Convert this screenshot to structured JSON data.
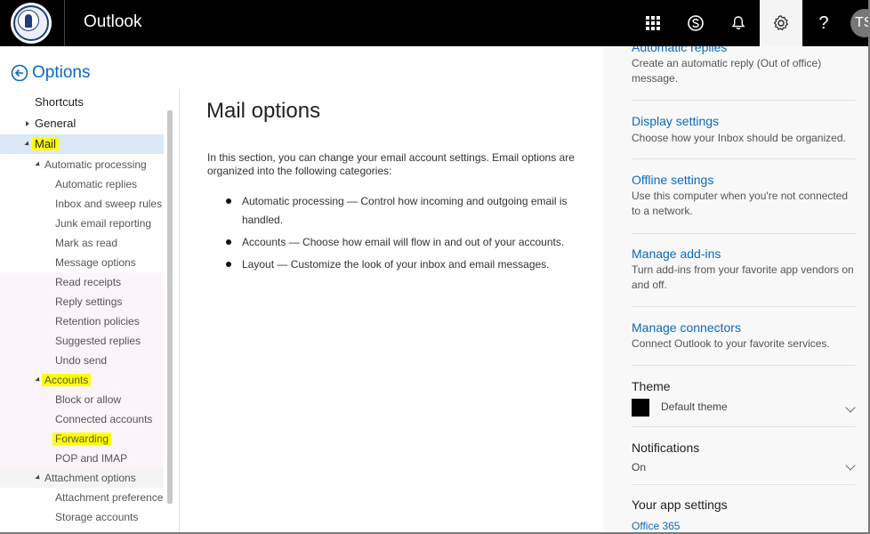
{
  "header": {
    "app_name": "Outlook",
    "avatar_initials": "TS",
    "icons": [
      "app-launcher-icon",
      "skype-icon",
      "bell-icon",
      "gear-icon",
      "help-icon"
    ],
    "help_glyph": "?"
  },
  "options_back": {
    "label": "Options"
  },
  "nav": {
    "shortcuts": "Shortcuts",
    "general": "General",
    "mail": "Mail",
    "automatic_processing": "Automatic processing",
    "automatic_replies": "Automatic replies",
    "inbox_rules": "Inbox and sweep rules",
    "junk": "Junk email reporting",
    "mark_read": "Mark as read",
    "message_options": "Message options",
    "read_receipts": "Read receipts",
    "reply_settings": "Reply settings",
    "retention": "Retention policies",
    "suggested_replies": "Suggested replies",
    "undo_send": "Undo send",
    "accounts": "Accounts",
    "block_allow": "Block or allow",
    "connected_accounts": "Connected accounts",
    "forwarding": "Forwarding",
    "pop_imap": "POP and IMAP",
    "attachment_options": "Attachment options",
    "attachment_preference": "Attachment preference",
    "storage_accounts": "Storage accounts"
  },
  "main": {
    "title": "Mail options",
    "intro": "In this section, you can change your email account settings. Email options are organized into the following categories:",
    "bullets": [
      "Automatic processing — Control how incoming and outgoing email is handled.",
      "Accounts — Choose how email will flow in and out of your accounts.",
      "Layout — Customize the look of your inbox and email messages."
    ]
  },
  "right_panel": {
    "automatic_replies": {
      "title": "Automatic replies",
      "desc": "Create an automatic reply (Out of office) message."
    },
    "display_settings": {
      "title": "Display settings",
      "desc": "Choose how your Inbox should be organized."
    },
    "offline_settings": {
      "title": "Offline settings",
      "desc": "Use this computer when you're not connected to a network."
    },
    "manage_addins": {
      "title": "Manage add-ins",
      "desc": "Turn add-ins from your favorite app vendors on and off."
    },
    "manage_connectors": {
      "title": "Manage connectors",
      "desc": "Connect Outlook to your favorite services."
    },
    "theme": {
      "heading": "Theme",
      "value": "Default theme",
      "swatch_color": "#000000"
    },
    "notifications": {
      "heading": "Notifications",
      "value": "On"
    },
    "app_settings": {
      "heading": "Your app settings",
      "link": "Office 365"
    }
  },
  "colors": {
    "link": "#0a6abf",
    "highlight": "#ffff00",
    "selected_bg": "#dbe9f7",
    "topbar": "#000000"
  }
}
